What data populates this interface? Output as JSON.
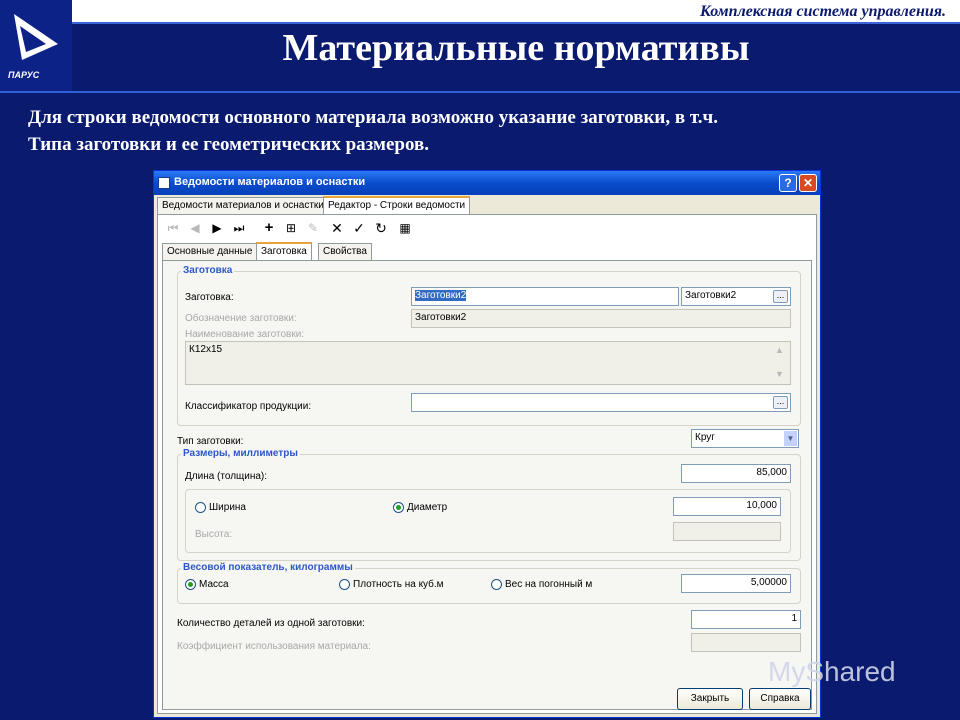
{
  "slide": {
    "header_text": "Комплексная система управления.",
    "title": "Материальные нормативы",
    "description_line1": "Для строки ведомости основного материала возможно указание заготовки, в т.ч.",
    "description_line2": "Типа заготовки и ее геометрических размеров.",
    "logo_text": "ПАРУС",
    "watermark": "MyShared"
  },
  "window": {
    "title": "Ведомости материалов и оснастки",
    "help_label": "?",
    "close_label": "✕",
    "outer_tabs": [
      "Ведомости материалов и оснастки",
      "Редактор - Строки ведомости"
    ],
    "inner_tabs": [
      "Основные данные",
      "Заготовка",
      "Свойства"
    ],
    "toolbar_icons": [
      "first-icon",
      "prev-icon",
      "next-icon",
      "last-icon",
      "add-icon",
      "add-copy-icon",
      "edit-icon",
      "delete-icon",
      "apply-icon",
      "refresh-icon",
      "table-icon"
    ]
  },
  "blank_group": {
    "title": "Заготовка",
    "blank_label": "Заготовка:",
    "blank_value": "Заготовки2",
    "blank_code": "Заготовки2",
    "designation_label": "Обозначение заготовки:",
    "designation_value": "Заготовки2",
    "name_label": "Наименование заготовки:",
    "name_value": "К12х15",
    "classifier_label": "Классификатор продукции:",
    "classifier_value": ""
  },
  "blank_type": {
    "label": "Тип заготовки:",
    "value": "Круг"
  },
  "sizes_group": {
    "title": "Размеры, миллиметры",
    "length_label": "Длина (толщина):",
    "length_value": "85,000",
    "width_label": "Ширина",
    "diameter_label": "Диаметр",
    "diameter_value": "10,000",
    "height_label": "Высота:",
    "height_value": ""
  },
  "weight_group": {
    "title": "Весовой показатель, килограммы",
    "mass_label": "Масса",
    "density_label": "Плотность на куб.м",
    "linear_label": "Вес на погонный м",
    "value": "5,00000"
  },
  "parts": {
    "count_label": "Количество деталей из одной заготовки:",
    "count_value": "1",
    "coef_label": "Коэффициент использования материала:",
    "coef_value": ""
  },
  "buttons": {
    "close": "Закрыть",
    "help": "Справка"
  }
}
